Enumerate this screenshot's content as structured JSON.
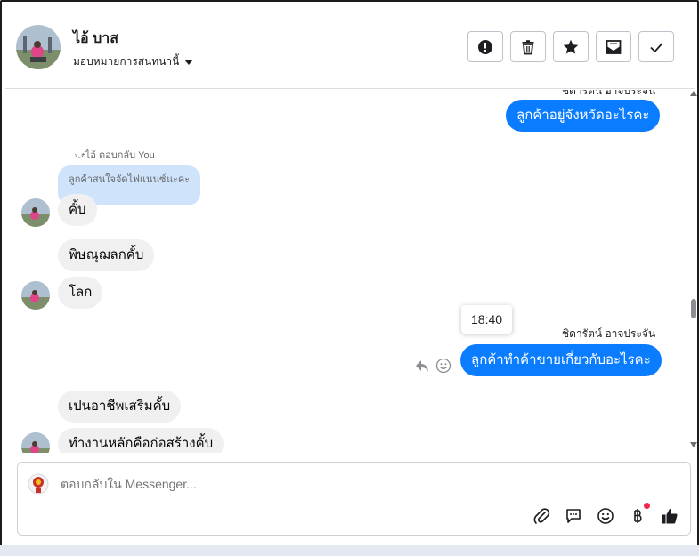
{
  "header": {
    "contact_name": "ไอ้ บาส",
    "assign_label": "มอบหมายการสนทนานี้",
    "actions": [
      {
        "name": "spam-button",
        "icon": "exclamation-circle-icon"
      },
      {
        "name": "delete-button",
        "icon": "trash-icon"
      },
      {
        "name": "star-button",
        "icon": "star-icon"
      },
      {
        "name": "mark-unread-button",
        "icon": "envelope-icon"
      },
      {
        "name": "done-button",
        "icon": "check-icon"
      }
    ]
  },
  "messages": {
    "m1_sender": "ชิดารัตน์ อาจประจัน",
    "m1_text": "ลูกค้าอยู่จังหวัดอะไรคะ",
    "reply_note": "ไอ้ ตอบกลับ You",
    "quoted_text": "ลูกค้าสนใจจัดไฟแนนซ์นะคะ",
    "m2_text": "คั้บ",
    "m3_text": "พิษณุฌลกคั้บ",
    "m4_text": "โลก",
    "tooltip_time": "18:40",
    "m5_sender": "ชิดารัตน์ อาจประจัน",
    "m5_text": "ลูกค้าทำค้าขายเกี่ยวกับอะไรคะ",
    "m6_text": "เปนอาชีพเสริมคั้บ",
    "m7_text": "ทำงานหลักคือก่อสร้างคั้บ"
  },
  "composer": {
    "placeholder": "ตอบกลับใน Messenger...",
    "tools": [
      "paperclip-icon",
      "speech-bubble-icon",
      "smiley-icon",
      "baht-icon",
      "thumbs-up-icon"
    ]
  },
  "colors": {
    "outgoing": "#0a7cff",
    "incoming": "#f0f0f0",
    "quoted": "#cfe3fb"
  }
}
